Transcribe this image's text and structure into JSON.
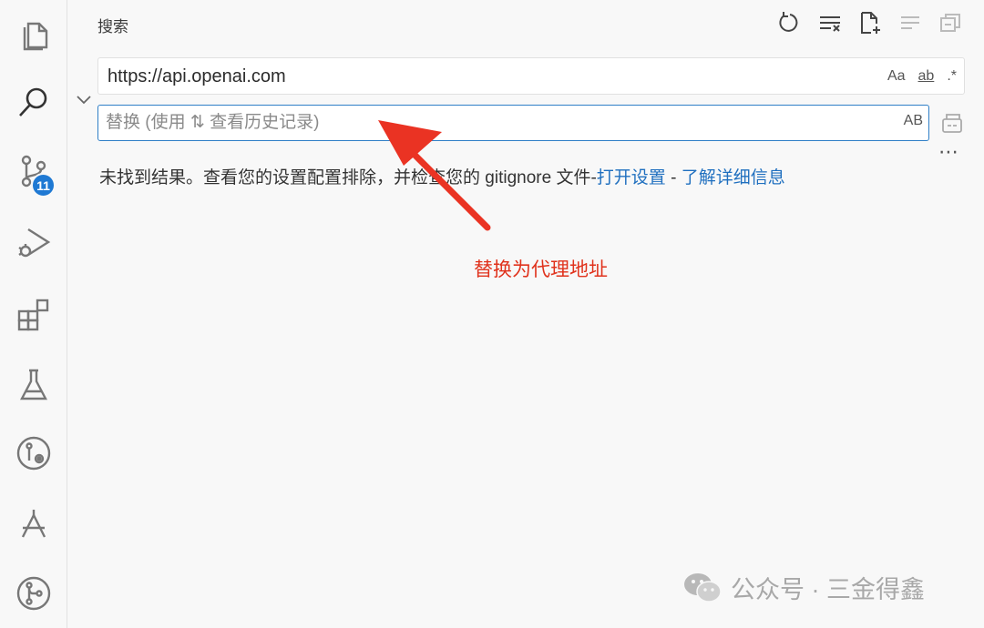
{
  "activity_bar": {
    "items": [
      {
        "name": "explorer"
      },
      {
        "name": "search"
      },
      {
        "name": "source-control",
        "badge": "11"
      },
      {
        "name": "run-debug"
      },
      {
        "name": "extensions"
      },
      {
        "name": "testing"
      },
      {
        "name": "git-graph"
      },
      {
        "name": "timeline"
      },
      {
        "name": "git-lens"
      }
    ]
  },
  "panel": {
    "title": "搜索"
  },
  "search": {
    "value": "https://api.openai.com",
    "options": {
      "match_case": "Aa",
      "whole_word": "ab",
      "regex": ".*"
    }
  },
  "replace": {
    "placeholder": "替换 (使用 ⇅ 查看历史记录)",
    "preserve_case": "AB"
  },
  "results": {
    "message_prefix": "未找到结果。查看您的设置配置排除，并检查您的 gitignore 文件-",
    "open_settings_link": "打开设置",
    "separator": " - ",
    "learn_more_link": "了解详细信息"
  },
  "annotation": {
    "text": "替换为代理地址"
  },
  "watermark": {
    "text": "公众号 · 三金得鑫"
  },
  "colors": {
    "accent": "#2f7fc7",
    "link": "#1f6fbf",
    "badge": "#1f79d3",
    "annotation": "#e0321c"
  }
}
